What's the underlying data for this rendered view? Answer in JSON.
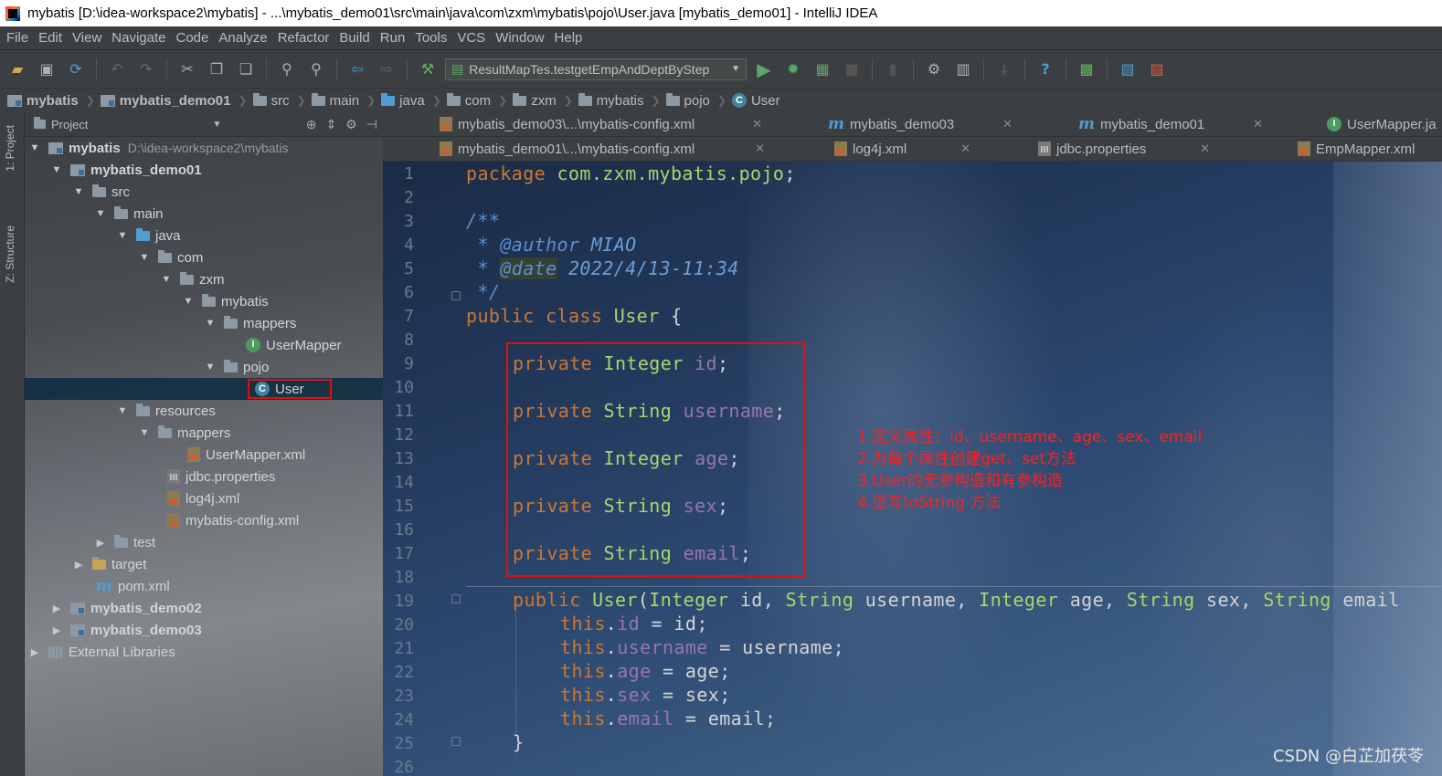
{
  "window": {
    "title": "mybatis [D:\\idea-workspace2\\mybatis] - ...\\mybatis_demo01\\src\\main\\java\\com\\zxm\\mybatis\\pojo\\User.java [mybatis_demo01] - IntelliJ IDEA"
  },
  "menu": [
    "File",
    "Edit",
    "View",
    "Navigate",
    "Code",
    "Analyze",
    "Refactor",
    "Build",
    "Run",
    "Tools",
    "VCS",
    "Window",
    "Help"
  ],
  "toolbar": {
    "run_config": "ResultMapTes.testgetEmpAndDeptByStep"
  },
  "breadcrumb": [
    "mybatis",
    "mybatis_demo01",
    "src",
    "main",
    "java",
    "com",
    "zxm",
    "mybatis",
    "pojo",
    "User"
  ],
  "tool_strip": {
    "project_tab": "1: Project",
    "structure_tab": "Z: Structure"
  },
  "project": {
    "header": "Project",
    "root_name": "mybatis",
    "root_path": "D:\\idea-workspace2\\mybatis",
    "items": [
      "mybatis_demo01",
      "src",
      "main",
      "java",
      "com",
      "zxm",
      "mybatis",
      "mappers",
      "UserMapper",
      "pojo",
      "User",
      "resources",
      "mappers",
      "UserMapper.xml",
      "jdbc.properties",
      "log4j.xml",
      "mybatis-config.xml",
      "test",
      "target",
      "pom.xml",
      "mybatis_demo02",
      "mybatis_demo03",
      "External Libraries"
    ]
  },
  "tabs": {
    "row1": [
      "mybatis_demo03\\...\\mybatis-config.xml",
      "mybatis_demo03",
      "mybatis_demo01",
      "UserMapper.ja"
    ],
    "row2": [
      "mybatis_demo01\\...\\mybatis-config.xml",
      "log4j.xml",
      "jdbc.properties",
      "EmpMapper.xml"
    ]
  },
  "editor": {
    "line_numbers": [
      "1",
      "2",
      "3",
      "4",
      "5",
      "6",
      "7",
      "8",
      "9",
      "10",
      "11",
      "12",
      "13",
      "14",
      "15",
      "16",
      "17",
      "18",
      "19",
      "20",
      "21",
      "22",
      "23",
      "24",
      "25",
      "26"
    ],
    "code": {
      "l1_kw": "package",
      "l1_pkg": "com.zxm.mybatis.pojo",
      "l1_end": ";",
      "l3": "/**",
      "l4_star": " * ",
      "l4_tag": "@author",
      "l4_val": " MIAO",
      "l5_star": " * ",
      "l5_tag": "@date",
      "l5_val": " 2022/4/13-11:34",
      "l6": " */",
      "l7_kw": "public class",
      "l7_name": "User",
      "l7_end": " {",
      "f1_kw": "private",
      "f1_type": "Integer",
      "f1_name": "id",
      "f1_end": ";",
      "f2_kw": "private",
      "f2_type": "String",
      "f2_name": "username",
      "f2_end": ";",
      "f3_kw": "private",
      "f3_type": "Integer",
      "f3_name": "age",
      "f3_end": ";",
      "f4_kw": "private",
      "f4_type": "String",
      "f4_name": "sex",
      "f4_end": ";",
      "f5_kw": "private",
      "f5_type": "String",
      "f5_name": "email",
      "f5_end": ";",
      "c_kw": "public",
      "c_name": "User",
      "c_open": "(",
      "c_t1": "Integer",
      "c_p1": " id, ",
      "c_t2": "String",
      "c_p2": " username, ",
      "c_t3": "Integer",
      "c_p3": " age, ",
      "c_t4": "String",
      "c_p4": " sex, ",
      "c_t5": "String",
      "c_p5": " email",
      "a1_this": "this",
      "a1_dot": ".",
      "a1_f": "id",
      "a1_rest": " = id;",
      "a2_this": "this",
      "a2_dot": ".",
      "a2_f": "username",
      "a2_rest": " = username;",
      "a3_this": "this",
      "a3_dot": ".",
      "a3_f": "age",
      "a3_rest": " = age;",
      "a4_this": "this",
      "a4_dot": ".",
      "a4_f": "sex",
      "a4_rest": " = sex;",
      "a5_this": "this",
      "a5_dot": ".",
      "a5_f": "email",
      "a5_rest": " = email;",
      "close": "}"
    }
  },
  "annotation": [
    "1.定义属性：id、username、age、sex、email",
    "2.为每个属性创建get、set方法",
    "3.User的无参构造和有参构造",
    "4.重写toString 方法"
  ],
  "watermark": "CSDN @白芷加茯苓",
  "colors": {
    "keyword": "#cc7832",
    "type": "#a9d66b",
    "field": "#9876aa",
    "annotation_red": "#ff2020",
    "selection_red": "#e01010"
  }
}
